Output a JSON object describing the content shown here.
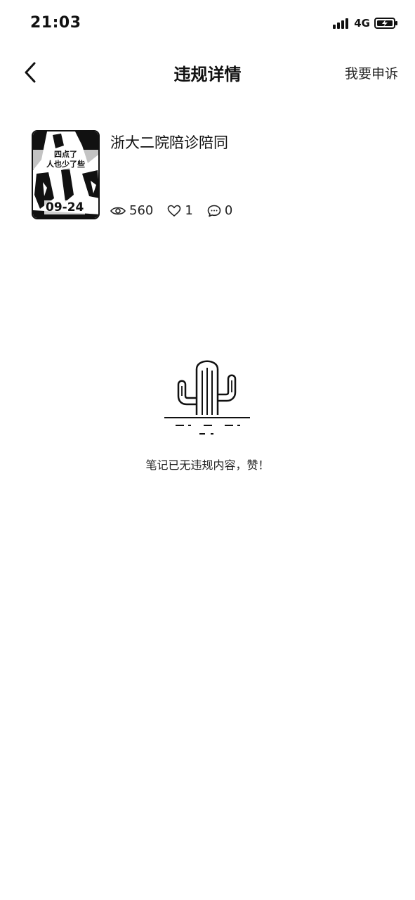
{
  "status_bar": {
    "time": "21:03",
    "network": "4G"
  },
  "nav": {
    "title": "违规详情",
    "appeal_label": "我要申诉",
    "back_icon": "chevron-left-icon"
  },
  "note": {
    "title": "浙大二院陪诊陪同",
    "thumbnail_caption_line1": "四点了",
    "thumbnail_caption_line2": "人也少了些",
    "thumbnail_date": "09-24",
    "views": "560",
    "likes": "1",
    "comments": "0"
  },
  "empty_state": {
    "icon": "cactus-icon",
    "message": "笔记已无违规内容，赞！"
  }
}
